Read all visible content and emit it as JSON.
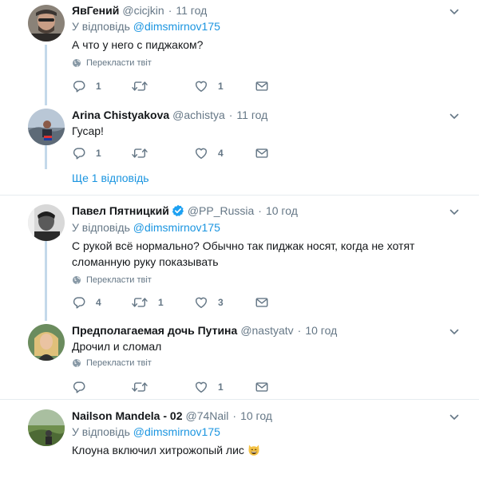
{
  "tweets": [
    {
      "name": "ЯвГений",
      "handle": "@cicjkin",
      "time": "11 год",
      "reply_prefix": "У відповідь",
      "reply_mention": "@dimsmirnov175",
      "text": "А что у него с пиджаком?",
      "translate": "Перекласти твіт",
      "replies": "1",
      "retweets": "",
      "likes": "1"
    },
    {
      "name": "Arina Chistyakova",
      "handle": "@achistya",
      "time": "11 год",
      "text": "Гусар!",
      "replies": "1",
      "retweets": "",
      "likes": "4",
      "more_replies": "Ще 1 відповідь"
    },
    {
      "name": "Павел Пятницкий",
      "handle": "@PP_Russia",
      "time": "10 год",
      "verified": true,
      "reply_prefix": "У відповідь",
      "reply_mention": "@dimsmirnov175",
      "text": "С рукой всё нормально? Обычно так пиджак носят, когда не хотят сломанную руку показывать",
      "translate": "Перекласти твіт",
      "replies": "4",
      "retweets": "1",
      "likes": "3"
    },
    {
      "name": "Предполагаемая дочь Путина",
      "handle": "@nastyatv",
      "time": "10 год",
      "text": "Дрочил и сломал",
      "translate": "Перекласти твіт",
      "replies": "",
      "retweets": "",
      "likes": "1"
    },
    {
      "name": "Nailson Mandela - 02",
      "handle": "@74Nail",
      "time": "10 год",
      "reply_prefix": "У відповідь",
      "reply_mention": "@dimsmirnov175",
      "text": "Клоуна включил хитрожопый лис",
      "emoji": "grinning-cat-emoji"
    }
  ],
  "colors": {
    "accent": "#1b95e0",
    "muted": "#657786",
    "thread_line": "#c4d9ea",
    "separator": "#e6ecf0"
  },
  "icons": [
    "reply-icon",
    "retweet-icon",
    "like-icon",
    "dm-icon",
    "globe-icon",
    "chevron-down-icon",
    "verified-badge-icon"
  ]
}
